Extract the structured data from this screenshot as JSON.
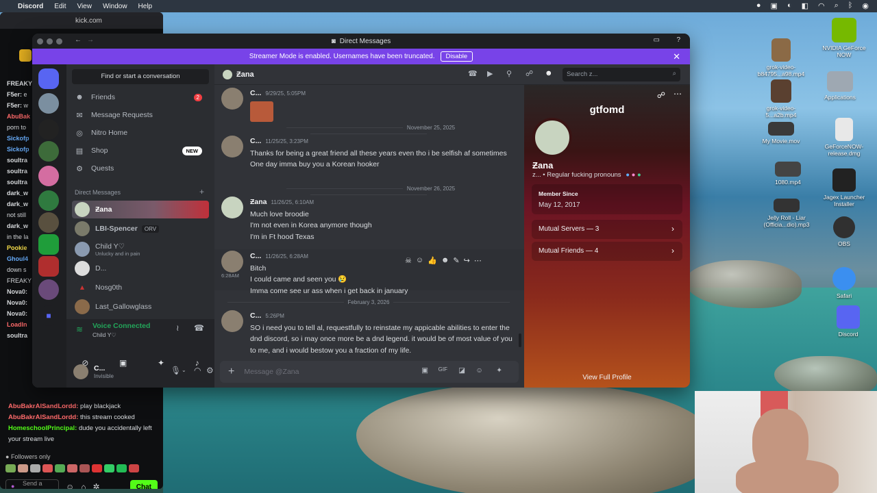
{
  "menubar": {
    "items": [
      "Discord",
      "Edit",
      "View",
      "Window",
      "Help"
    ]
  },
  "kick": {
    "tab_title": "kick.com",
    "chat_lines": [
      {
        "user": "FREAKY",
        "text": ""
      },
      {
        "user": "F5er:",
        "text": "e"
      },
      {
        "user": "F5er:",
        "text": "w"
      },
      {
        "user": "AbuBak",
        "text": ""
      },
      {
        "user": "",
        "text": "porn to"
      },
      {
        "user": "Sickofp",
        "text": ""
      },
      {
        "user": "Sickofp",
        "text": ""
      },
      {
        "user": "soultra",
        "text": ""
      },
      {
        "user": "soultra",
        "text": ""
      },
      {
        "user": "soultra",
        "text": ""
      },
      {
        "user": "dark_w",
        "text": ""
      },
      {
        "user": "dark_w",
        "text": ""
      },
      {
        "user": "",
        "text": "not still"
      },
      {
        "user": "dark_w",
        "text": ""
      },
      {
        "user": "",
        "text": "in the la"
      },
      {
        "user": "Pookie",
        "text": ""
      },
      {
        "user": "Ghoul4",
        "text": ""
      },
      {
        "user": "",
        "text": "down s"
      },
      {
        "user": "",
        "text": "FREAKY"
      },
      {
        "user": "Nova0:",
        "text": ""
      },
      {
        "user": "Nova0:",
        "text": ""
      },
      {
        "user": "Nova0:",
        "text": ""
      },
      {
        "user": "LoadIn",
        "text": ""
      },
      {
        "user": "soultra",
        "text": ""
      }
    ],
    "bottom_lines": [
      {
        "user": "AbuBakrAlSandLordd:",
        "text": " play blackjack"
      },
      {
        "user": "AbuBakrAlSandLordd:",
        "text": " this stream cooked"
      },
      {
        "user": "HomeschoolPrincipal:",
        "text": " dude you accidentally left your stream live"
      }
    ],
    "followers_only": "Followers only",
    "send_placeholder": "Send a message",
    "chat_button": "Chat"
  },
  "discord": {
    "window_title": "Direct Messages",
    "banner_text": "Streamer Mode is enabled. Usernames have been truncated.",
    "banner_button": "Disable",
    "search_conversation": "Find or start a conversation",
    "nav": {
      "friends": "Friends",
      "friends_badge": "2",
      "message_requests": "Message Requests",
      "nitro_home": "Nitro Home",
      "shop": "Shop",
      "shop_badge": "NEW",
      "quests": "Quests"
    },
    "dm_header": "Direct Messages",
    "dms": [
      {
        "name": "Ƶana",
        "status": ""
      },
      {
        "name": "LBI-Spencer",
        "status": "ORV"
      },
      {
        "name": "Child Y♡",
        "status": "Unlucky and in pain"
      },
      {
        "name": "D...",
        "status": ""
      },
      {
        "name": "Nosg0th",
        "status": ""
      },
      {
        "name": "Last_Gallowglass",
        "status": ""
      }
    ],
    "voice": {
      "status": "Voice Connected",
      "channel": "Child Y♡"
    },
    "user": {
      "name": "C...",
      "status": "Invisible"
    },
    "chat": {
      "recipient": "Ƶana",
      "search_placeholder": "Search z...",
      "messages": [
        {
          "author": "C...",
          "time": "9/29/25, 5:05PM",
          "lines": []
        },
        {
          "date": "November 25, 2025"
        },
        {
          "author": "C...",
          "time": "11/25/25, 3:23PM",
          "lines": [
            "Thanks for being a great friend all these years even tho i be selfish af sometimes",
            "One day imma buy you a Korean hooker"
          ]
        },
        {
          "date": "November 26, 2025"
        },
        {
          "author": "Ƶana",
          "time": "11/26/25, 6:10AM",
          "lines": [
            "Much love broodie",
            "I'm not even in Korea anymore though",
            "I'm in Ft hood Texas"
          ]
        },
        {
          "author": "C...",
          "time": "11/26/25, 6:28AM",
          "lines": [
            "Bitch",
            "I could came and seen you 😢",
            "Imma come see ur ass when i get back in january"
          ],
          "inline_time": "6:28AM"
        },
        {
          "date": "February 3, 2026"
        },
        {
          "author": "C...",
          "time": "5:26PM",
          "lines": [
            "SO i need you to tell al, requestfully to reinstate my appicable abilities to enter the dnd discord, so i may once more be a dnd legend. it would be of most value of you to me, and i would bestow you a fraction of my life."
          ]
        }
      ],
      "input_placeholder": "Message @Zana"
    },
    "profile": {
      "display": "gtfomd",
      "name": "Ƶana",
      "tag": "z...",
      "pronouns": "Regular fucking pronouns",
      "member_since_label": "Member Since",
      "member_since": "May 12, 2017",
      "mutual_servers": "Mutual Servers — 3",
      "mutual_friends": "Mutual Friends — 4",
      "view_full": "View Full Profile"
    }
  },
  "desktop_icons": [
    {
      "label": "NVIDIA GeForce NOW"
    },
    {
      "label": "grok-video-b84795...a98.mp4"
    },
    {
      "label": "Applications"
    },
    {
      "label": "grok-video-5...a2b.mp4"
    },
    {
      "label": "My Movie.mov"
    },
    {
      "label": "GeForceNOW-release.dmg"
    },
    {
      "label": "1080.mp4"
    },
    {
      "label": "Jagex Launcher Installer"
    },
    {
      "label": "Jelly Roll - Liar (Officia...dio).mp3"
    },
    {
      "label": "OBS"
    },
    {
      "label": "Safari"
    },
    {
      "label": "Discord"
    }
  ]
}
